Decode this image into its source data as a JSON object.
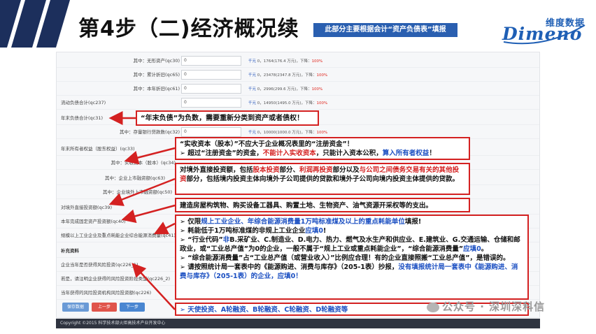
{
  "header": {
    "step_title": "第4步（二)经济概况续",
    "banner": "此部分主要根据会计“资产负债表”填报",
    "logo_cn": "维度数据",
    "logo_en": "Dimeno"
  },
  "form": {
    "rows": [
      {
        "label": "其中：无形资产(qc30)",
        "value": "0",
        "extra_unit": "千元",
        "extra_mid": "0，1764(176.4 万元)，下降：",
        "extra_pct": "100%"
      },
      {
        "label": "其中：累计折旧(qc65)",
        "value": "0",
        "extra_unit": "千元",
        "extra_mid": "0，23478(2347.8 万元)，下降：",
        "extra_pct": "100%"
      },
      {
        "label": "其中：本年折旧(qc61)",
        "value": "0",
        "extra_unit": "千元",
        "extra_mid": "0，2996(299.6 万元)，下降：",
        "extra_pct": "100%"
      },
      {
        "label": "流动负债合计(qc237)",
        "value": "0",
        "extra_unit": "千元",
        "extra_mid": "0，14950(1495.0 万元)，下降：",
        "extra_pct": "100%"
      },
      {
        "label": "年末负债合计(qc31)",
        "value": "",
        "extra_unit": "",
        "extra_mid": "",
        "extra_pct": ""
      },
      {
        "label": "其中：存量银行贷款数(qc32)",
        "value": "0",
        "extra_unit": "千元",
        "extra_mid": "0，10000(1000.0 万元)，下降：",
        "extra_pct": "100%"
      },
      {
        "label": "年末所有者权益（股东权益）(qc33)",
        "value": "",
        "extra_unit": "",
        "extra_mid": "",
        "extra_pct": ""
      },
      {
        "label": "其中：实收资本（股本）(qc34)",
        "value": "",
        "extra_unit": "",
        "extra_mid": "",
        "extra_pct": ""
      },
      {
        "label": "其中：企业上市融资额(qc63)",
        "value": "",
        "extra_unit": "",
        "extra_mid": "",
        "extra_pct": ""
      },
      {
        "label": "其中：企业境外上市融资额(qc50)",
        "value": "",
        "extra_unit": "",
        "extra_mid": "",
        "extra_pct": ""
      },
      {
        "label": "对境外直接投资额(qc39)",
        "value": "",
        "extra_unit": "",
        "extra_mid": "",
        "extra_pct": ""
      },
      {
        "label": "本年完成固定资产投资额(qc40)",
        "value": "",
        "extra_unit": "",
        "extra_mid": "",
        "extra_pct": ""
      },
      {
        "label": "规模以上工业企业及重点耗能企业综合能源消费量(qc41)",
        "value": "",
        "extra_unit": "",
        "extra_mid": "",
        "extra_pct": ""
      },
      {
        "label": "补充资料",
        "value": "",
        "extra_unit": "",
        "extra_mid": "",
        "extra_pct": ""
      },
      {
        "label": "企业当年是否获得风险投资(qc226_1)",
        "value": "",
        "extra_unit": "",
        "extra_mid": "",
        "extra_pct": ""
      },
      {
        "label": "若是，请注明企业获得的风险投资阶段类型(qc226_2)",
        "value": "",
        "extra_unit": "",
        "extra_mid": "",
        "extra_pct": ""
      },
      {
        "label": "当年获得的风险投资机构风险投资额(qc226)",
        "value": "",
        "extra_unit": "",
        "extra_mid": "",
        "extra_pct": ""
      }
    ],
    "buttons": {
      "save": "保存数据",
      "prev": "上一步",
      "next": "下一步"
    }
  },
  "footer": {
    "copyright": "Copyright ©2015 科学技术部火炬高技术产业开发中心"
  },
  "notes": {
    "n1": "“年末负债”为负数，需要重新分类到资产或者债权！",
    "n2_l1": "“实收资本（股本）”不应大于企业概况表里的“注册资金”！",
    "n2_l2a": "➢ 超过“注册资金”的资金，",
    "n2_l2b": "不能计入实收资本",
    "n2_l2c": "，只能计入资本公积，",
    "n2_l2d": "算入所有者权益",
    "n2_l2e": "！",
    "n3_a": "对境外直接投资额，包括",
    "n3_b": "股本投资",
    "n3_c": "部分、",
    "n3_d": "利润再投资",
    "n3_e": "部分以及",
    "n3_f": "与公司之间债务交易有关的其他投资",
    "n3_g": "部分，包括境内投资主体向境外子公司提供的贷款和境外子公司向境内投资主体提供的贷款。",
    "n4": "建造房屋构筑物、购买设备工器具、购置土地、生物资产、油气资源开采权等的支出。",
    "n5_1a": "➢ 仅限",
    "n5_1b": "规上工业企业、年综合能源消费量1万吨标准煤及以上的重点耗能单位",
    "n5_1c": "填报!",
    "n5_2a": "➢ 耗能低于1万吨标准煤的非规上工业企业",
    "n5_2b": "应填0",
    "n5_2c": "!",
    "n5_3a": "➢ “行业代码”",
    "n5_3b": "非",
    "n5_3c": "B.采矿业、C.制造业、D.电力、热力、燃气及水生产和供应业、E.建筑业、G.交通运输、仓储和邮政业，或“工业总产值”为0的企业，一般不属于“规上工业或重点耗能企业”，“综合能源消费量”",
    "n5_3d": "应填0",
    "n5_3e": "。",
    "n5_4": "➢ “综合能源消费量”占“工业总产值（或营业收入）”比例应合理！有的企业直接照搬“工业总产值”，是错误的。",
    "n5_5a": "➢ 请按照统计局一套表中的《能源购进、消费与库存》（205-1表）抄报，",
    "n5_5b": "没有填报统计局一套表中《能源购进、消费与库存》（205-1表）的企业，应填0！",
    "n6": "➢ 天使投资、A轮融资、B轮融资、C轮融资、D轮融资等"
  },
  "watermark": "公众号 · 深圳深科信",
  "colors": {
    "accent_red": "#d42121",
    "accent_blue": "#1b4fc2",
    "banner_blue": "#2a5fb0",
    "chevron_navy": "#1c2f5c"
  }
}
